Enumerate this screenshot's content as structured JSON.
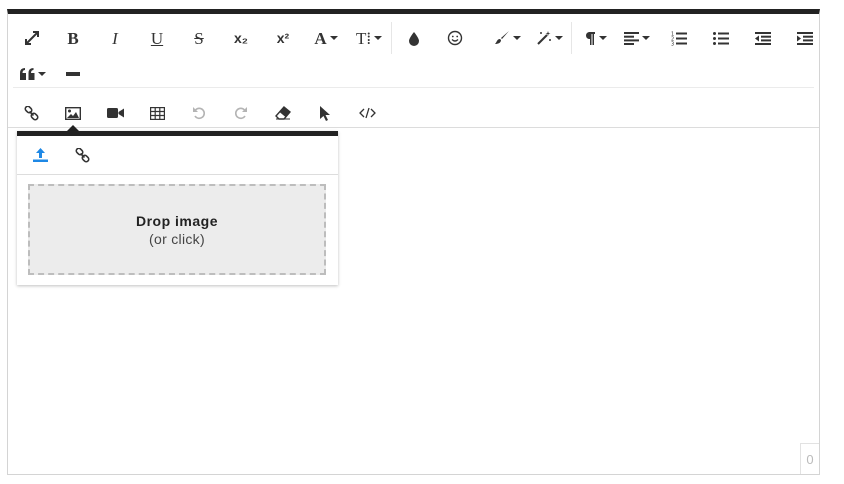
{
  "toolbar": {
    "bold_label": "B",
    "italic_label": "I",
    "underline_label": "U",
    "strike_label": "S",
    "subscript_label": "x₂",
    "superscript_label": "x²",
    "font_family_label": "A",
    "font_size_label": "T⁞"
  },
  "popup": {
    "drop_title": "Drop image",
    "drop_subtitle": "(or click)",
    "active_tab": "upload",
    "accent_color": "#1e88e5"
  },
  "editor": {
    "char_count": "0"
  }
}
